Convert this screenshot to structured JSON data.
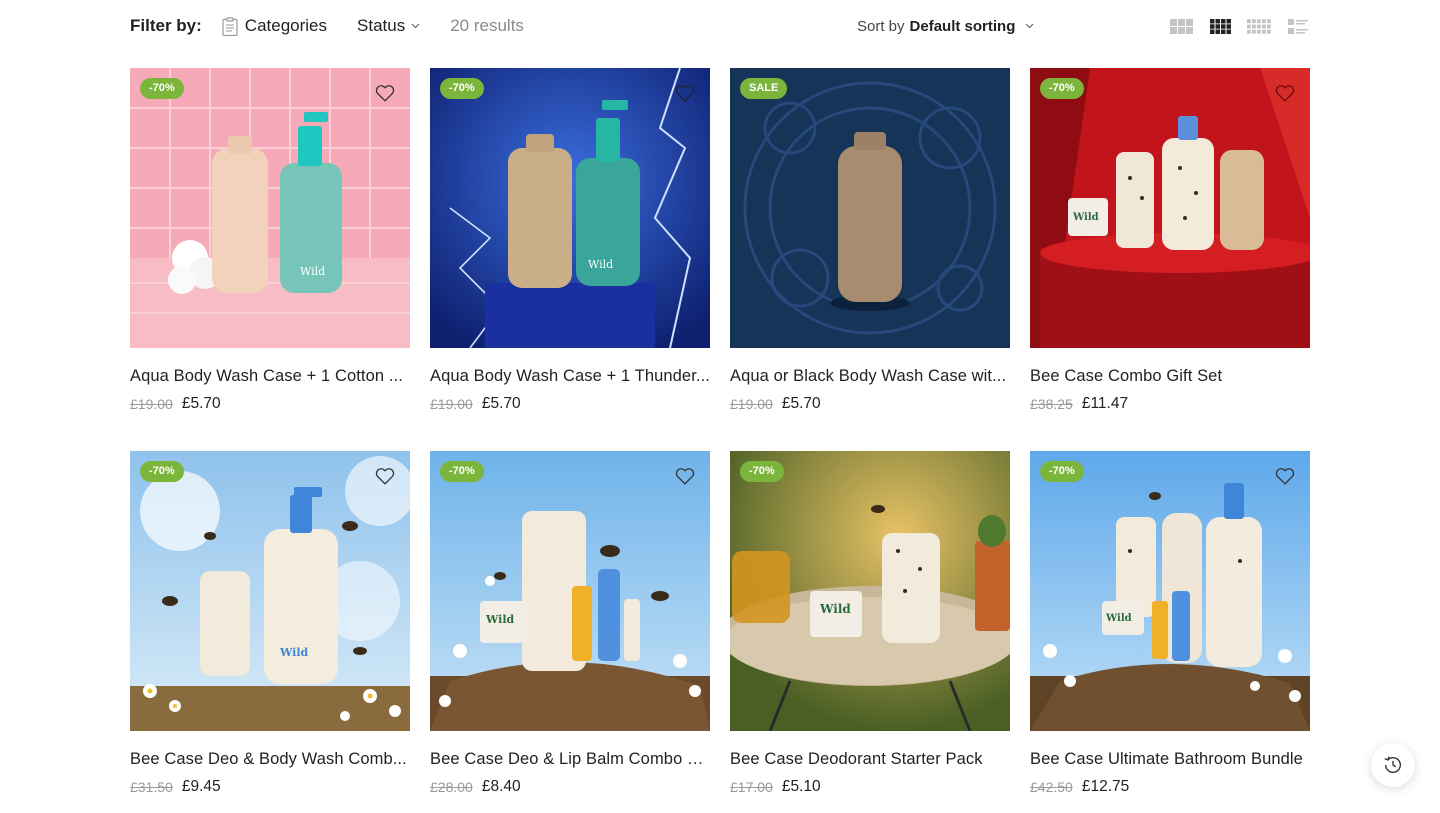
{
  "toolbar": {
    "filter_label": "Filter by:",
    "categories_label": "Categories",
    "status_label": "Status",
    "results_text": "20 results",
    "sort_prefix": "Sort by",
    "sort_value": "Default sorting",
    "view_icons": [
      "grid-3-icon",
      "grid-4-icon",
      "grid-5-icon",
      "list-view-icon"
    ],
    "active_view": "grid-4-icon"
  },
  "products": [
    {
      "title": "Aqua Body Wash Case + 1 Cotton ...",
      "badge": "-70%",
      "old_price": "£19.00",
      "price": "£5.70"
    },
    {
      "title": "Aqua Body Wash Case + 1 Thunder...",
      "badge": "-70%",
      "old_price": "£19.00",
      "price": "£5.70"
    },
    {
      "title": "Aqua or Black Body Wash Case wit...",
      "badge": "SALE",
      "old_price": "£19.00",
      "price": "£5.70"
    },
    {
      "title": "Bee Case Combo Gift Set",
      "badge": "-70%",
      "old_price": "£38.25",
      "price": "£11.47"
    },
    {
      "title": "Bee Case Deo & Body Wash Comb...",
      "badge": "-70%",
      "old_price": "£31.50",
      "price": "£9.45"
    },
    {
      "title": "Bee Case Deo & Lip Balm Combo S...",
      "badge": "-70%",
      "old_price": "£28.00",
      "price": "£8.40"
    },
    {
      "title": "Bee Case Deodorant Starter Pack",
      "badge": "-70%",
      "old_price": "£17.00",
      "price": "£5.10"
    },
    {
      "title": "Bee Case Ultimate Bathroom Bundle",
      "badge": "-70%",
      "old_price": "£42.50",
      "price": "£12.75"
    }
  ],
  "colors": {
    "badge_green": "#7bb53b",
    "text_dark": "#222222",
    "text_muted": "#8a8a8a",
    "old_price": "#999999"
  },
  "icons": {
    "wishlist": "heart-icon",
    "categories": "clipboard-icon",
    "dropdown": "chevron-down-icon",
    "history": "history-icon"
  }
}
